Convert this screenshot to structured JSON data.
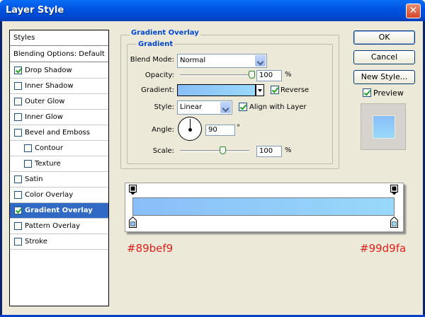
{
  "window": {
    "title": "Layer Style"
  },
  "styles_list": {
    "header": "Styles",
    "blending": "Blending Options: Default",
    "items": [
      {
        "label": "Drop Shadow",
        "checked": true,
        "indent": false
      },
      {
        "label": "Inner Shadow",
        "checked": false,
        "indent": false
      },
      {
        "label": "Outer Glow",
        "checked": false,
        "indent": false
      },
      {
        "label": "Inner Glow",
        "checked": false,
        "indent": false
      },
      {
        "label": "Bevel and Emboss",
        "checked": false,
        "indent": false
      },
      {
        "label": "Contour",
        "checked": false,
        "indent": true
      },
      {
        "label": "Texture",
        "checked": false,
        "indent": true
      },
      {
        "label": "Satin",
        "checked": false,
        "indent": false
      },
      {
        "label": "Color Overlay",
        "checked": false,
        "indent": false
      },
      {
        "label": "Gradient Overlay",
        "checked": true,
        "indent": false,
        "selected": true
      },
      {
        "label": "Pattern Overlay",
        "checked": false,
        "indent": false
      },
      {
        "label": "Stroke",
        "checked": false,
        "indent": false
      }
    ]
  },
  "panel": {
    "title": "Gradient Overlay",
    "group": "Gradient",
    "blend_mode_label": "Blend Mode:",
    "blend_mode": "Normal",
    "opacity_label": "Opacity:",
    "opacity": "100",
    "opacity_value": 100,
    "percent": "%",
    "gradient_label": "Gradient:",
    "reverse_label": "Reverse",
    "reverse_checked": true,
    "style_label": "Style:",
    "style": "Linear",
    "align_label": "Align with Layer",
    "align_checked": true,
    "angle_label": "Angle:",
    "angle": "90",
    "degree": "°",
    "scale_label": "Scale:",
    "scale": "100",
    "scale_value": 100
  },
  "buttons": {
    "ok": "OK",
    "cancel": "Cancel",
    "new_style": "New Style...",
    "preview_label": "Preview",
    "preview_checked": true
  },
  "gradient": {
    "left_color": "#89bef9",
    "right_color": "#99d9fa",
    "left_label": "#89bef9",
    "right_label": "#99d9fa"
  },
  "colors": {
    "title_blue": "#0054e3",
    "selection": "#316ac5",
    "group_title": "#0046d5",
    "hex_label": "#e0201c"
  }
}
